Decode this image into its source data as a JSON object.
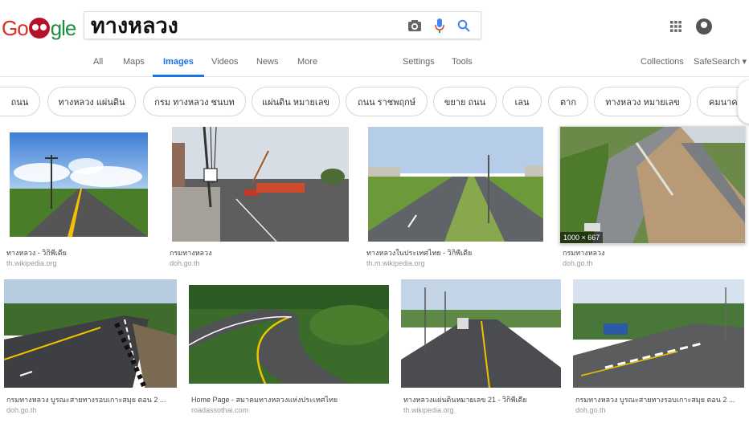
{
  "logo": {
    "letters": [
      "Go",
      "gle"
    ]
  },
  "search": {
    "query": "ทางหลวง"
  },
  "tabs": [
    {
      "label": "All"
    },
    {
      "label": "Maps"
    },
    {
      "label": "Images"
    },
    {
      "label": "Videos"
    },
    {
      "label": "News"
    },
    {
      "label": "More"
    },
    {
      "label": "Settings"
    },
    {
      "label": "Tools"
    },
    {
      "label": "Collections"
    },
    {
      "label": "SafeSearch ▾"
    }
  ],
  "active_tab": "Images",
  "chips": [
    {
      "label": "ถนน"
    },
    {
      "label": "ทางหลวง แผ่นดิน"
    },
    {
      "label": "กรม ทางหลวง ชนบท"
    },
    {
      "label": "แผ่นดิน หมายเลข"
    },
    {
      "label": "ถนน ราชพฤกษ์"
    },
    {
      "label": "ขยาย ถนน"
    },
    {
      "label": "เลน"
    },
    {
      "label": "ตาก"
    },
    {
      "label": "ทางหลวง หมายเลข"
    },
    {
      "label": "คมนาคม"
    }
  ],
  "results": [
    {
      "title": "ทางหลวง - วิกิพีเดีย",
      "source": "th.wikipedia.org"
    },
    {
      "title": "กรมทางหลวง",
      "source": "doh.go.th"
    },
    {
      "title": "ทางหลวงในประเทศไทย - วิกิพีเดีย",
      "source": "th.m.wikipedia.org"
    },
    {
      "title": "กรมทางหลวง",
      "source": "doh.go.th",
      "dimensions": "1000 × 667"
    },
    {
      "title": "กรมทางหลวง บูรณะสายทางรอบเกาะสมุย ตอน 2 ...",
      "source": "doh.go.th"
    },
    {
      "title": "Home Page - สมาคมทางหลวงแห่งประเทศไทย",
      "source": "roadassothai.com"
    },
    {
      "title": "ทางหลวงแผ่นดินหมายเลข 21 - วิกิพีเดีย",
      "source": "th.wikipedia.org"
    },
    {
      "title": "กรมทางหลวง บูรณะสายทางรอบเกาะสมุย ตอน 2 ...",
      "source": "doh.go.th"
    }
  ],
  "colors": {
    "accent": "#1a73e8",
    "logo_red": "#b5122a"
  }
}
